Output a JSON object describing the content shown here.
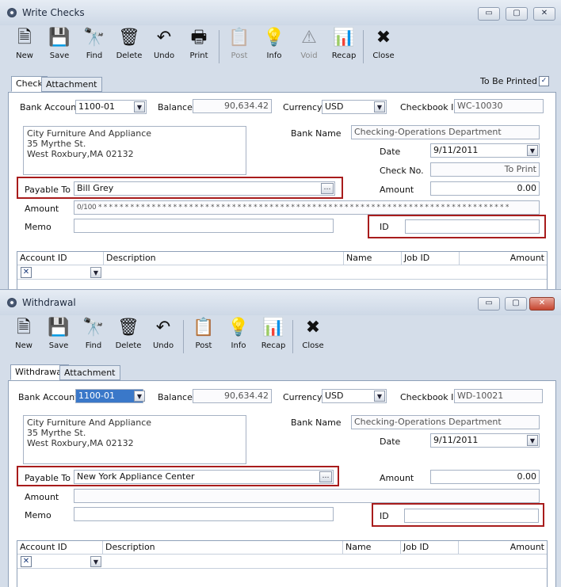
{
  "write_checks": {
    "title": "Write Checks",
    "window_controls": {
      "minimize": "▭",
      "maximize": "▢",
      "close": "✕"
    },
    "toolbar": [
      {
        "label": "New",
        "icon": "new-document-icon",
        "glyph": "🗎",
        "enabled": true
      },
      {
        "label": "Save",
        "icon": "floppy-disk-icon",
        "glyph": "💾",
        "enabled": true
      },
      {
        "label": "Find",
        "icon": "binoculars-icon",
        "glyph": "🔭",
        "enabled": true
      },
      {
        "label": "Delete",
        "icon": "trash-can-icon",
        "glyph": "🗑",
        "enabled": true
      },
      {
        "label": "Undo",
        "icon": "undo-arrow-icon",
        "glyph": "↶",
        "enabled": true
      },
      {
        "label": "Print",
        "icon": "printer-icon",
        "glyph": "🖶",
        "enabled": true
      },
      {
        "label": "Post",
        "icon": "post-icon",
        "glyph": "📋",
        "enabled": false
      },
      {
        "label": "Info",
        "icon": "info-icon",
        "glyph": "💡",
        "enabled": true
      },
      {
        "label": "Void",
        "icon": "void-icon",
        "glyph": "⚠",
        "enabled": false
      },
      {
        "label": "Recap",
        "icon": "recap-icon",
        "glyph": "📊",
        "enabled": true
      },
      {
        "label": "Close",
        "icon": "close-window-icon",
        "glyph": "✖",
        "enabled": true
      }
    ],
    "tabs": [
      "Check",
      "Attachment"
    ],
    "to_be_printed_label": "To Be Printed",
    "to_be_printed_checked": true,
    "check_mark": "✓",
    "bank_account_label": "Bank Account",
    "bank_account_value": "1100-01",
    "balance_label": "Balance",
    "balance_value": "90,634.42",
    "currency_label": "Currency",
    "currency_value": "USD",
    "checkbook_id_label": "Checkbook ID",
    "checkbook_id_value": "WC-10030",
    "address": [
      "City Furniture And Appliance",
      "35 Myrthe St.",
      "West Roxbury,MA 02132"
    ],
    "bank_name_label": "Bank Name",
    "bank_name_value": "Checking-Operations Department",
    "date_label": "Date",
    "date_value": "9/11/2011",
    "check_no_label": "Check No.",
    "check_no_value": "To Print",
    "payable_to_label": "Payable To",
    "payable_to_value": "Bill Grey",
    "amount_label": "Amount",
    "amount_value": "0.00",
    "amount_words_label": "Amount",
    "amount_words_value": "0/100 * * * * * * * * * * * * * * * * * * * * * * * * * * * * * * * * * * * * * * * * * * * * * * * * * * * * * * * * * * * * * * * * * * * * * * * * * * * * *",
    "memo_label": "Memo",
    "memo_value": "",
    "id_label": "ID",
    "id_value": "",
    "grid_headers": [
      "Account ID",
      "Description",
      "Name",
      "Job ID",
      "Amount"
    ],
    "row_check_glyph": "✕"
  },
  "withdrawal": {
    "title": "Withdrawal",
    "window_controls": {
      "minimize": "▭",
      "maximize": "▢",
      "close": "✕"
    },
    "toolbar": [
      {
        "label": "New",
        "icon": "new-document-icon",
        "glyph": "🗎",
        "enabled": true
      },
      {
        "label": "Save",
        "icon": "floppy-disk-icon",
        "glyph": "💾",
        "enabled": true
      },
      {
        "label": "Find",
        "icon": "binoculars-icon",
        "glyph": "🔭",
        "enabled": true
      },
      {
        "label": "Delete",
        "icon": "trash-can-icon",
        "glyph": "🗑",
        "enabled": true
      },
      {
        "label": "Undo",
        "icon": "undo-arrow-icon",
        "glyph": "↶",
        "enabled": true
      },
      {
        "label": "Post",
        "icon": "post-icon",
        "glyph": "📋",
        "enabled": true
      },
      {
        "label": "Info",
        "icon": "info-icon",
        "glyph": "💡",
        "enabled": true
      },
      {
        "label": "Recap",
        "icon": "recap-icon",
        "glyph": "📊",
        "enabled": true
      },
      {
        "label": "Close",
        "icon": "close-window-icon",
        "glyph": "✖",
        "enabled": true
      }
    ],
    "tabs": [
      "Withdrawal",
      "Attachment"
    ],
    "bank_account_label": "Bank Account",
    "bank_account_value": "1100-01",
    "balance_label": "Balance",
    "balance_value": "90,634.42",
    "currency_label": "Currency",
    "currency_value": "USD",
    "checkbook_id_label": "Checkbook ID",
    "checkbook_id_value": "WD-10021",
    "address": [
      "City Furniture And Appliance",
      "35 Myrthe St.",
      "West Roxbury,MA 02132"
    ],
    "bank_name_label": "Bank Name",
    "bank_name_value": "Checking-Operations Department",
    "date_label": "Date",
    "date_value": "9/11/2011",
    "payable_to_label": "Payable To",
    "payable_to_value": "New York Appliance Center",
    "amount_label": "Amount",
    "amount_value": "0.00",
    "amount_words_label": "Amount",
    "amount_words_value": "",
    "memo_label": "Memo",
    "memo_value": "",
    "id_label": "ID",
    "id_value": "",
    "grid_headers": [
      "Account ID",
      "Description",
      "Name",
      "Job ID",
      "Amount"
    ],
    "row_check_glyph": "✕"
  },
  "shared": {
    "dropdown_glyph": "▼",
    "ellipsis_glyph": "…"
  },
  "colors": {
    "highlight_border": "#a81c1c",
    "window_bg": "#d4dde9",
    "selection": "#3a78c9"
  }
}
